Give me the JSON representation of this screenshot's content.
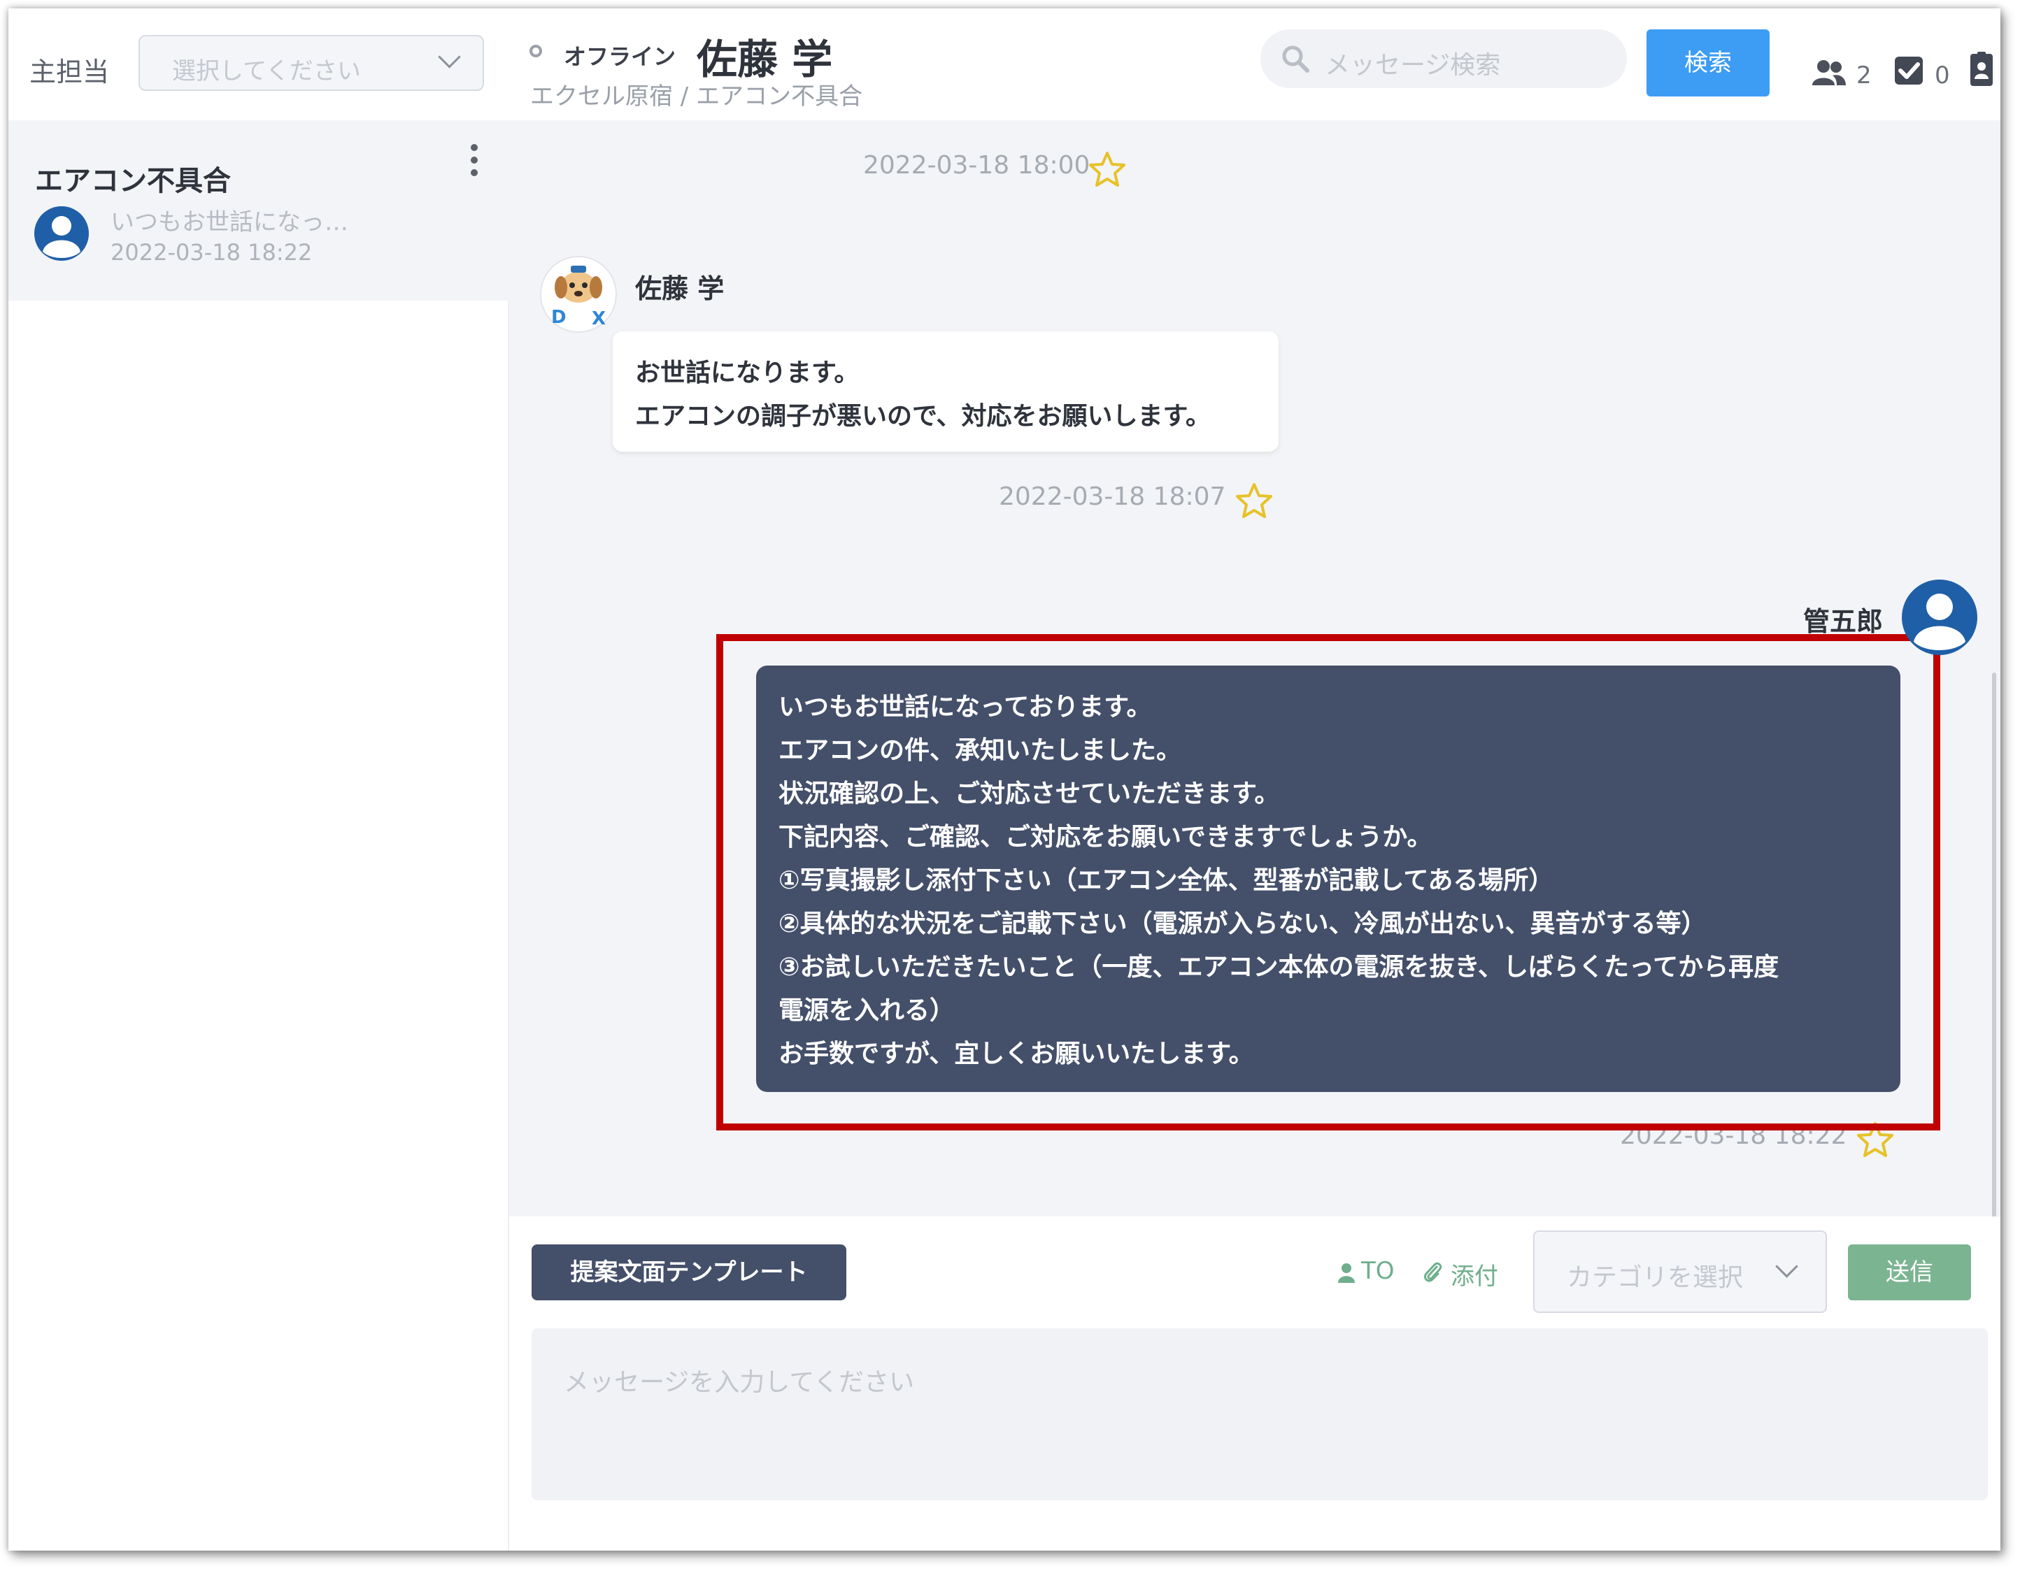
{
  "header": {
    "owner_label": "主担当",
    "owner_placeholder": "選択してください",
    "status": "オフライン",
    "contact_name": "佐藤 学",
    "breadcrumb": "エクセル原宿 / エアコン不具合",
    "search_placeholder": "メッセージ検索",
    "search_button": "検索",
    "members_count": "2",
    "tasks_count": "0"
  },
  "sidebar": {
    "room": {
      "title": "エアコン不具合",
      "preview": "いつもお世話になっ…",
      "time": "2022-03-18 18:22"
    }
  },
  "messages": {
    "first_timestamp": "2022-03-18 18:00",
    "incoming": {
      "sender": "佐藤 学",
      "lines": [
        "お世話になります。",
        "エアコンの調子が悪いので、対応をお願いします。"
      ],
      "timestamp": "2022-03-18 18:07"
    },
    "outgoing": {
      "sender": "管五郎",
      "lines": [
        "いつもお世話になっております。",
        "エアコンの件、承知いたしました。",
        "状況確認の上、ご対応させていただきます。",
        "下記内容、ご確認、ご対応をお願いできますでしょうか。",
        "①写真撮影し添付下さい（エアコン全体、型番が記載してある場所）",
        "②具体的な状況をご記載下さい（電源が入らない、冷風が出ない、異音がする等）",
        "③お試しいただきたいこと（一度、エアコン本体の電源を抜き、しばらくたってから再度",
        "電源を入れる）",
        "お手数ですが、宜しくお願いいたします。"
      ],
      "timestamp": "2022-03-18 18:22"
    }
  },
  "composer": {
    "template_button": "提案文面テンプレート",
    "to_label": "TO",
    "attach_label": "添付",
    "category_placeholder": "カテゴリを選択",
    "send_button": "送信",
    "input_placeholder": "メッセージを入力してください"
  },
  "colors": {
    "accent_blue": "#3d9cf4",
    "outgoing_bubble": "#444f6a",
    "send_green": "#7bb491",
    "highlight_red": "#c00000",
    "star_yellow": "#e6c229"
  },
  "icons": [
    "search-icon",
    "members-icon",
    "checkbox-icon",
    "contact-card-icon",
    "kebab-icon",
    "star-icon",
    "person-icon",
    "paperclip-icon",
    "chevron-down-icon"
  ]
}
